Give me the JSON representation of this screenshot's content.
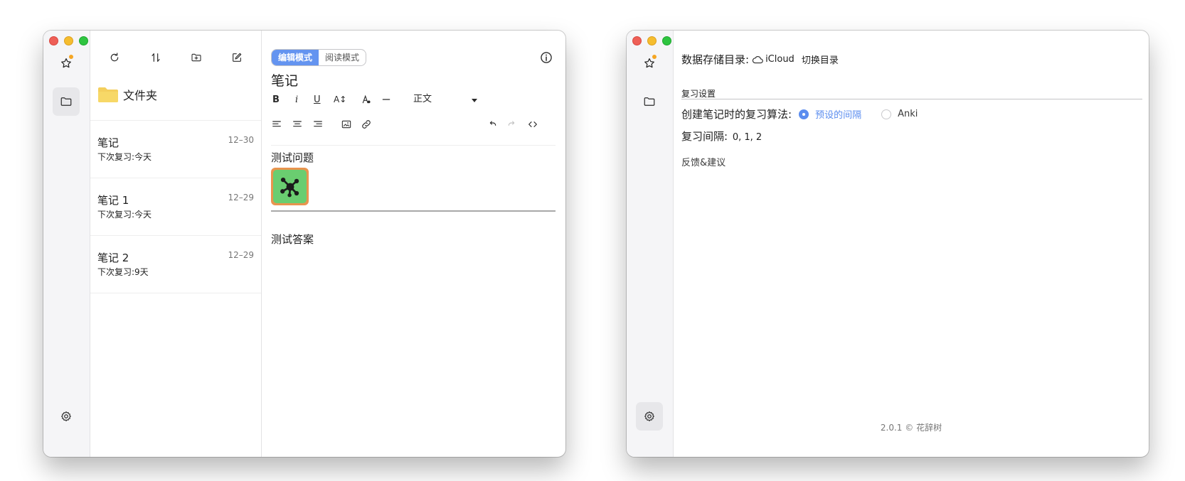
{
  "window1": {
    "rail": {
      "star_icon": "star-icon",
      "folder_icon": "folder-icon",
      "settings_icon": "gear-icon"
    },
    "list_toolbar": [
      "refresh-icon",
      "sort-icon",
      "new-folder-icon",
      "compose-icon"
    ],
    "folder": {
      "name": "文件夹",
      "icon": "folder-yellow-icon",
      "color": "#f4cf5d"
    },
    "notes": [
      {
        "title": "笔记",
        "date": "12–30",
        "subtitle": "下次复习:今天"
      },
      {
        "title": "笔记 1",
        "date": "12–29",
        "subtitle": "下次复习:今天"
      },
      {
        "title": "笔记 2",
        "date": "12–29",
        "subtitle": "下次复习:9天"
      }
    ],
    "editor": {
      "mode_edit": "编辑模式",
      "mode_read": "阅读模式",
      "title": "笔记",
      "toolbar": {
        "bold": "B",
        "italic": "i",
        "underline": "U",
        "font_size": "A↕",
        "text_style": "正文"
      },
      "question": "测试问题",
      "answer": "测试答案"
    }
  },
  "window2": {
    "storage_label": "数据存储目录:",
    "storage_value": "iCloud",
    "switch_dir": "切换目录",
    "section_title": "复习设置",
    "algo_label": "创建笔记时的复习算法:",
    "algo_option1": "预设的间隔",
    "algo_option2": "Anki",
    "algo_selected": "预设的间隔",
    "interval_label": "复习间隔:",
    "interval_value": "0, 1, 2",
    "feedback": "反馈&建议",
    "version": "2.0.1 © 花辞树"
  },
  "colors": {
    "accent": "#5b8def",
    "mode_active": "#6494f0",
    "badge": "#f5a623"
  }
}
